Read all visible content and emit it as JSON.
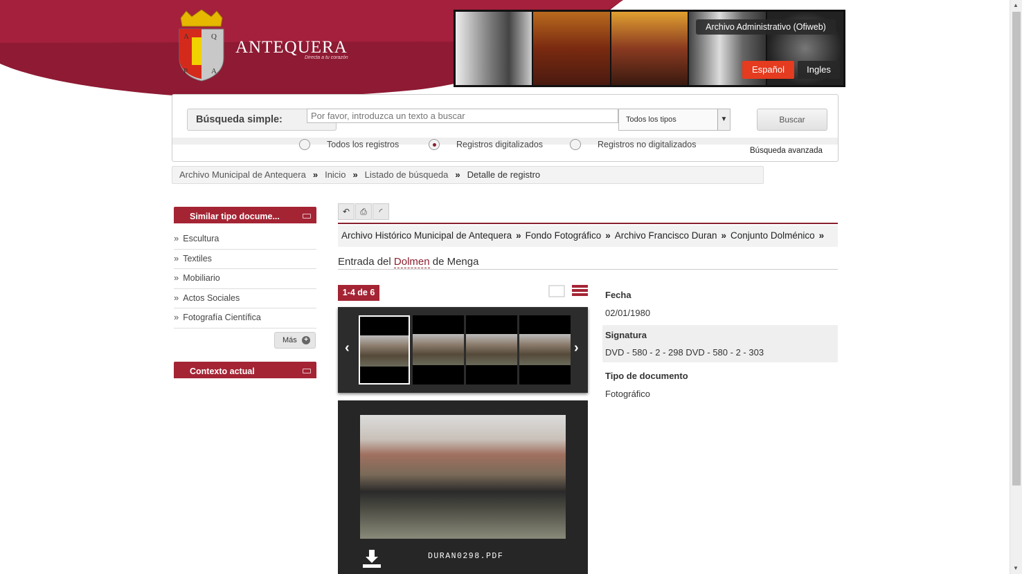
{
  "header": {
    "brand": "ANTEQUERA",
    "tagline": "Directa a tu corazón",
    "banner_title": "Archivo Administrativo (Ofiweb)",
    "lang_es": "Español",
    "lang_en": "Ingles",
    "colors": {
      "primary": "#8a1f2e",
      "accent": "#e53b1f"
    }
  },
  "search": {
    "label": "Búsqueda simple:",
    "placeholder": "Por favor, introduzca un texto a buscar",
    "type_selected": "Todos los tipos",
    "button": "Buscar",
    "radios": [
      {
        "label": "Todos los registros",
        "checked": false
      },
      {
        "label": "Registros digitalizados",
        "checked": true
      },
      {
        "label": "Registros no digitalizados",
        "checked": false
      }
    ],
    "advanced": "Búsqueda avanzada"
  },
  "breadcrumb": {
    "items": [
      "Archivo Municipal de Antequera",
      "Inicio",
      "Listado de búsqueda"
    ],
    "current": "Detalle de registro",
    "separator": "»"
  },
  "sidebar": {
    "similar_title": "Similar tipo docume...",
    "items": [
      "Escultura",
      "Textiles",
      "Mobiliario",
      "Actos Sociales",
      "Fotografía Científica"
    ],
    "more": "Más",
    "context_title": "Contexto actual"
  },
  "record": {
    "path": [
      "Archivo Histórico Municipal de Antequera",
      "Fondo Fotográfico",
      "Archivo Francisco Duran",
      "Conjunto Dolménico"
    ],
    "title_pre": "Entrada del ",
    "title_hl": "Dolmen",
    "title_post": " de Menga",
    "counter": "1-4 de 6",
    "file_name": "DURAN0298.PDF",
    "fields": [
      {
        "label": "Fecha",
        "value": "02/01/1980"
      },
      {
        "label": "Signatura",
        "value": "DVD - 580 - 2 - 298 DVD - 580 - 2 - 303"
      },
      {
        "label": "Tipo de documento",
        "value": "Fotográfico"
      }
    ]
  },
  "icons": [
    "back-icon",
    "print-icon",
    "rss-icon",
    "monitor-icon",
    "list-view-icon",
    "download-icon",
    "prev-arrow-icon",
    "next-arrow-icon",
    "folder-icon",
    "plus-icon"
  ]
}
